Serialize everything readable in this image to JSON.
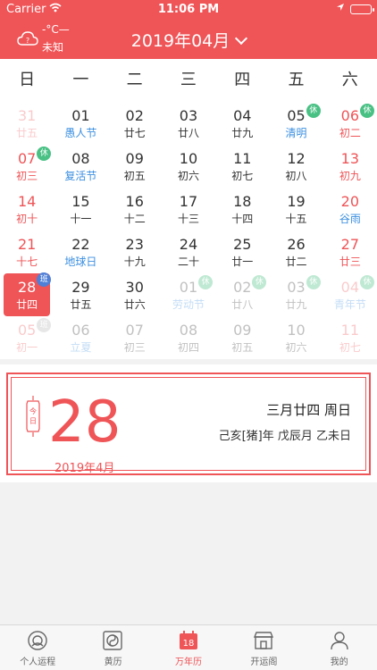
{
  "status_bar": {
    "carrier": "Carrier",
    "time": "11:06 PM"
  },
  "header": {
    "temperature": "-°C—",
    "city": "未知",
    "month_title": "2019年04月"
  },
  "weekdays": [
    "日",
    "一",
    "二",
    "三",
    "四",
    "五",
    "六"
  ],
  "calendar": {
    "rows": [
      [
        {
          "day": "31",
          "lunar": "廿五",
          "faded": true,
          "weekend": true
        },
        {
          "day": "01",
          "lunar": "愚人节",
          "festival": true
        },
        {
          "day": "02",
          "lunar": "廿七"
        },
        {
          "day": "03",
          "lunar": "廿八"
        },
        {
          "day": "04",
          "lunar": "廿九"
        },
        {
          "day": "05",
          "lunar": "清明",
          "festival": true,
          "badge": "休"
        },
        {
          "day": "06",
          "lunar": "初二",
          "weekend": true,
          "badge": "休"
        }
      ],
      [
        {
          "day": "07",
          "lunar": "初三",
          "weekend": true,
          "badge": "休"
        },
        {
          "day": "08",
          "lunar": "复活节",
          "festival": true
        },
        {
          "day": "09",
          "lunar": "初五"
        },
        {
          "day": "10",
          "lunar": "初六"
        },
        {
          "day": "11",
          "lunar": "初七"
        },
        {
          "day": "12",
          "lunar": "初八"
        },
        {
          "day": "13",
          "lunar": "初九",
          "weekend": true
        }
      ],
      [
        {
          "day": "14",
          "lunar": "初十",
          "weekend": true
        },
        {
          "day": "15",
          "lunar": "十一"
        },
        {
          "day": "16",
          "lunar": "十二"
        },
        {
          "day": "17",
          "lunar": "十三"
        },
        {
          "day": "18",
          "lunar": "十四"
        },
        {
          "day": "19",
          "lunar": "十五"
        },
        {
          "day": "20",
          "lunar": "谷雨",
          "festival": true,
          "weekend": true
        }
      ],
      [
        {
          "day": "21",
          "lunar": "十七",
          "weekend": true
        },
        {
          "day": "22",
          "lunar": "地球日",
          "festival": true
        },
        {
          "day": "23",
          "lunar": "十九"
        },
        {
          "day": "24",
          "lunar": "二十"
        },
        {
          "day": "25",
          "lunar": "廿一"
        },
        {
          "day": "26",
          "lunar": "廿二"
        },
        {
          "day": "27",
          "lunar": "廿三",
          "weekend": true
        }
      ],
      [
        {
          "day": "28",
          "lunar": "廿四",
          "weekend": true,
          "selected": true,
          "badge": "班"
        },
        {
          "day": "29",
          "lunar": "廿五"
        },
        {
          "day": "30",
          "lunar": "廿六"
        },
        {
          "day": "01",
          "lunar": "劳动节",
          "faded": true,
          "festival": true,
          "badge": "休"
        },
        {
          "day": "02",
          "lunar": "廿八",
          "faded": true,
          "badge": "休"
        },
        {
          "day": "03",
          "lunar": "廿九",
          "faded": true,
          "badge": "休"
        },
        {
          "day": "04",
          "lunar": "青年节",
          "faded": true,
          "festival": true,
          "weekend": true,
          "badge": "休"
        }
      ],
      [
        {
          "day": "05",
          "lunar": "初一",
          "faded": true,
          "weekend": true,
          "badge": "班"
        },
        {
          "day": "06",
          "lunar": "立夏",
          "faded": true,
          "festival": true
        },
        {
          "day": "07",
          "lunar": "初三",
          "faded": true
        },
        {
          "day": "08",
          "lunar": "初四",
          "faded": true
        },
        {
          "day": "09",
          "lunar": "初五",
          "faded": true
        },
        {
          "day": "10",
          "lunar": "初六",
          "faded": true
        },
        {
          "day": "11",
          "lunar": "初七",
          "faded": true,
          "weekend": true
        }
      ]
    ]
  },
  "detail": {
    "today_tag": "今日",
    "big_day": "28",
    "year_month": "2019年4月",
    "lunar_date": "三月廿四  周日",
    "ganzhi": "己亥[猪]年 戊辰月 乙未日"
  },
  "tabs": [
    {
      "label": "个人运程",
      "icon": "fortune-icon"
    },
    {
      "label": "黄历",
      "icon": "almanac-icon"
    },
    {
      "label": "万年历",
      "icon": "calendar-icon",
      "active": true,
      "icon_text": "18"
    },
    {
      "label": "开运阁",
      "icon": "shop-icon"
    },
    {
      "label": "我的",
      "icon": "profile-icon"
    }
  ],
  "colors": {
    "accent": "#ef5457",
    "festival": "#3b8fe0",
    "rest_badge": "#49c184",
    "work_badge": "#bbbbbb"
  }
}
